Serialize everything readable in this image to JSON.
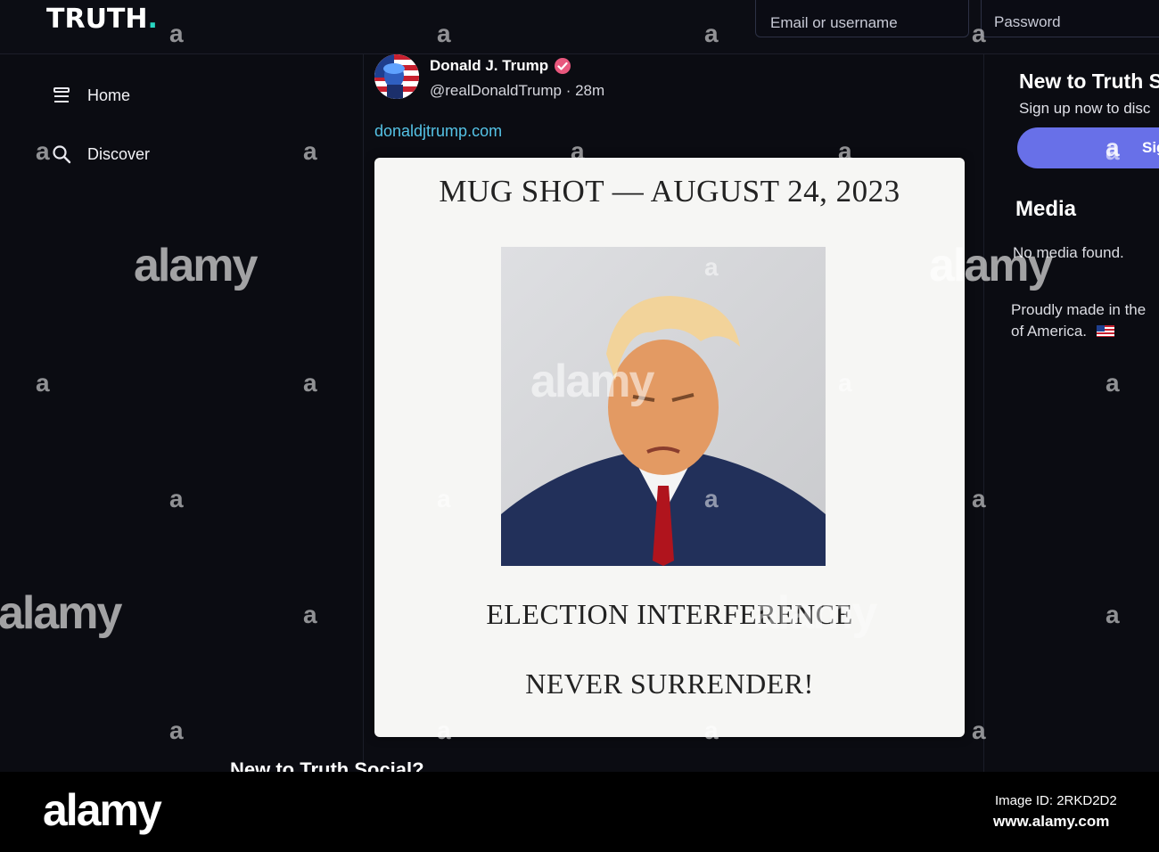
{
  "app": {
    "logo_text": "TRUTH",
    "logo_dot": ".",
    "accent_color": "#28d6c2"
  },
  "login": {
    "email_placeholder": "Email or username",
    "password_placeholder": "Password"
  },
  "nav": {
    "items": [
      {
        "label": "Home",
        "icon": "menu-lines-icon"
      },
      {
        "label": "Discover",
        "icon": "search-icon"
      }
    ]
  },
  "post": {
    "author_name": "Donald J. Trump",
    "verified": true,
    "handle": "@realDonaldTrump",
    "separator": " · ",
    "time": "28m",
    "link": "donaldjtrump.com",
    "link_color": "#55c3e6",
    "image": {
      "title": "MUG SHOT — AUGUST 24, 2023",
      "line1": "ELECTION INTERFERENCE",
      "line2": "NEVER SURRENDER!"
    }
  },
  "below_feed": {
    "heading": "New to Truth Social?"
  },
  "sidebar_right": {
    "title": "New to Truth S",
    "subtitle": "Sign up now to disc",
    "signup_label": "Sig",
    "signup_color": "#6870e8",
    "media_title": "Media",
    "media_empty": "No media found.",
    "made_in": "Proudly made in the",
    "made_in_line2": "of America."
  },
  "watermark": {
    "brand": "alamy",
    "small_mark": "a"
  },
  "footer": {
    "logo": "alamy",
    "image_id": "Image ID: 2RKD2D2",
    "url": "www.alamy.com"
  }
}
